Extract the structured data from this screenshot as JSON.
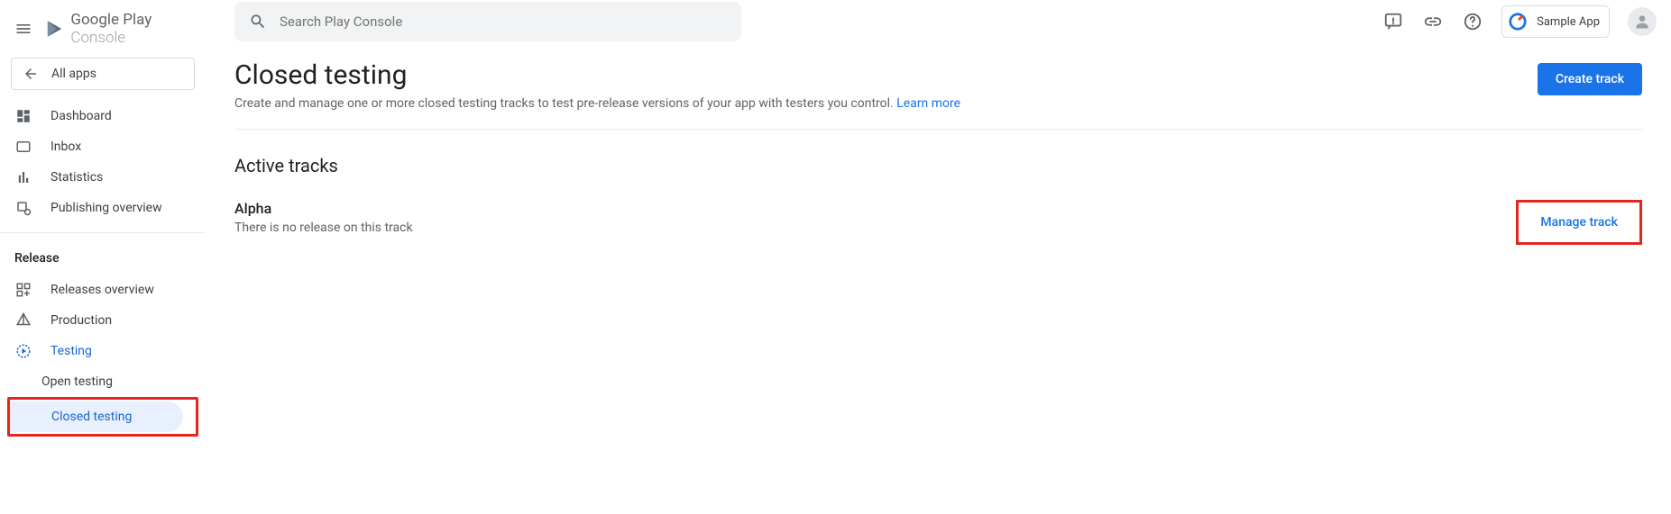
{
  "header": {
    "brand_product": "Google Play",
    "brand_suffix": "Console",
    "search_placeholder": "Search Play Console",
    "app_chip_label": "Sample App"
  },
  "sidebar": {
    "all_apps": "All apps",
    "items_top": [
      {
        "label": "Dashboard"
      },
      {
        "label": "Inbox"
      },
      {
        "label": "Statistics"
      },
      {
        "label": "Publishing overview"
      }
    ],
    "section_release": "Release",
    "items_release": [
      {
        "label": "Releases overview"
      },
      {
        "label": "Production"
      },
      {
        "label": "Testing"
      }
    ],
    "sub_items": [
      {
        "label": "Open testing"
      },
      {
        "label": "Closed testing"
      }
    ]
  },
  "page": {
    "title": "Closed testing",
    "subtitle_text": "Create and manage one or more closed testing tracks to test pre-release versions of your app with testers you control. ",
    "subtitle_link": "Learn more",
    "create_track_btn": "Create track",
    "section_title": "Active tracks",
    "track": {
      "name": "Alpha",
      "status": "There is no release on this track",
      "manage_btn": "Manage track"
    }
  }
}
